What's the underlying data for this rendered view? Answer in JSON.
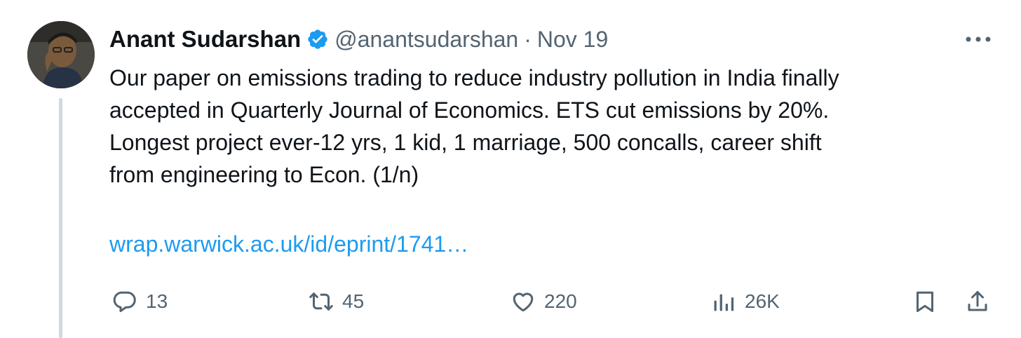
{
  "author": {
    "name": "Anant Sudarshan",
    "handle": "@anantsudarshan",
    "separator": "·",
    "date": "Nov 19",
    "verified_color": "#1d9bf0"
  },
  "tweet": {
    "lines": [
      "Our paper on emissions trading to reduce industry pollution in India finally",
      "accepted in Quarterly Journal of Economics. ETS cut emissions by 20%.",
      "Longest project ever-12 yrs, 1 kid, 1 marriage, 500 concalls, career shift",
      "from engineering to Econ. (1/n)"
    ],
    "link_text": "wrap.warwick.ac.uk/id/eprint/1741…"
  },
  "actions": {
    "replies": "13",
    "retweets": "45",
    "likes": "220",
    "views": "26K"
  },
  "icons": [
    "more-icon",
    "verified-icon",
    "reply-icon",
    "retweet-icon",
    "like-icon",
    "views-icon",
    "bookmark-icon",
    "share-icon"
  ],
  "colors": {
    "text": "#0f1419",
    "secondary": "#536471",
    "link": "#1d9bf0",
    "thread_line": "#cfd9de"
  }
}
